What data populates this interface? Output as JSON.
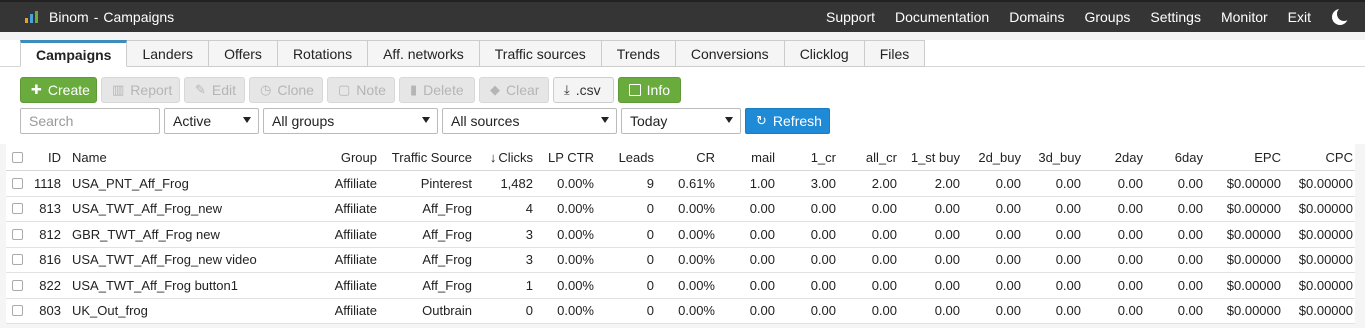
{
  "app": {
    "brand": "Binom",
    "separator": "-",
    "page": "Campaigns",
    "logo_colors": [
      "#e6a023",
      "#4aa3df",
      "#6aab3d"
    ]
  },
  "topnav": [
    "Support",
    "Documentation",
    "Domains",
    "Groups",
    "Settings",
    "Monitor",
    "Exit"
  ],
  "tabs": [
    "Campaigns",
    "Landers",
    "Offers",
    "Rotations",
    "Aff. networks",
    "Traffic sources",
    "Trends",
    "Conversions",
    "Clicklog",
    "Files"
  ],
  "active_tab": "Campaigns",
  "toolbar": {
    "create": "Create",
    "report": "Report",
    "edit": "Edit",
    "clone": "Clone",
    "note": "Note",
    "delete": "Delete",
    "clear": "Clear",
    "csv": ".csv",
    "info": "Info"
  },
  "filters": {
    "search_placeholder": "Search",
    "status": "Active",
    "group": "All groups",
    "source": "All sources",
    "period": "Today",
    "refresh": "Refresh"
  },
  "table": {
    "columns": [
      "ID",
      "Name",
      "Group",
      "Traffic Source",
      "Clicks",
      "LP CTR",
      "Leads",
      "CR",
      "mail",
      "1_cr",
      "all_cr",
      "1_st buy",
      "2d_buy",
      "3d_buy",
      "2day",
      "6day",
      "EPC",
      "CPC"
    ],
    "sorted_column": "Clicks",
    "rows": [
      [
        "1118",
        "USA_PNT_Aff_Frog",
        "Affiliate",
        "Pinterest",
        "1,482",
        "0.00%",
        "9",
        "0.61%",
        "1.00",
        "3.00",
        "2.00",
        "2.00",
        "0.00",
        "0.00",
        "0.00",
        "0.00",
        "$0.00000",
        "$0.00000"
      ],
      [
        "813",
        "USA_TWT_Aff_Frog_new",
        "Affiliate",
        "Aff_Frog",
        "4",
        "0.00%",
        "0",
        "0.00%",
        "0.00",
        "0.00",
        "0.00",
        "0.00",
        "0.00",
        "0.00",
        "0.00",
        "0.00",
        "$0.00000",
        "$0.00000"
      ],
      [
        "812",
        "GBR_TWT_Aff_Frog new",
        "Affiliate",
        "Aff_Frog",
        "3",
        "0.00%",
        "0",
        "0.00%",
        "0.00",
        "0.00",
        "0.00",
        "0.00",
        "0.00",
        "0.00",
        "0.00",
        "0.00",
        "$0.00000",
        "$0.00000"
      ],
      [
        "816",
        "USA_TWT_Aff_Frog_new video",
        "Affiliate",
        "Aff_Frog",
        "3",
        "0.00%",
        "0",
        "0.00%",
        "0.00",
        "0.00",
        "0.00",
        "0.00",
        "0.00",
        "0.00",
        "0.00",
        "0.00",
        "$0.00000",
        "$0.00000"
      ],
      [
        "822",
        "USA_TWT_Aff_Frog button1",
        "Affiliate",
        "Aff_Frog",
        "1",
        "0.00%",
        "0",
        "0.00%",
        "0.00",
        "0.00",
        "0.00",
        "0.00",
        "0.00",
        "0.00",
        "0.00",
        "0.00",
        "$0.00000",
        "$0.00000"
      ],
      [
        "803",
        "UK_Out_frog",
        "Affiliate",
        "Outbrain",
        "0",
        "0.00%",
        "0",
        "0.00%",
        "0.00",
        "0.00",
        "0.00",
        "0.00",
        "0.00",
        "0.00",
        "0.00",
        "0.00",
        "$0.00000",
        "$0.00000"
      ]
    ]
  }
}
